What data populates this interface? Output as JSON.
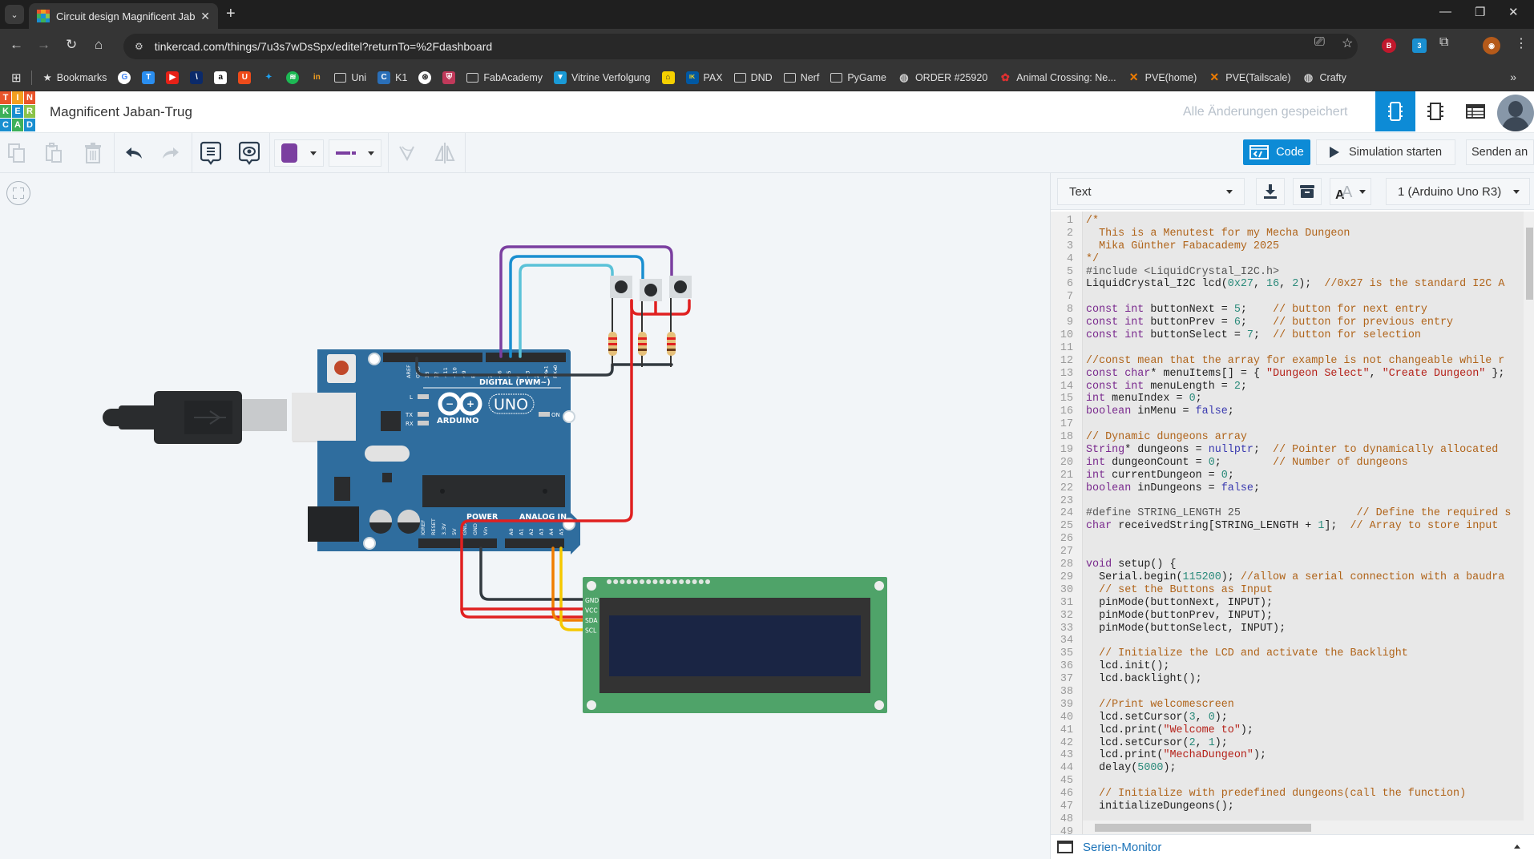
{
  "browser": {
    "tab_title": "Circuit design Magnificent Jaban-Trug",
    "url": "tinkercad.com/things/7u3s7wDsSpx/editel?returnTo=%2Fdashboard",
    "bookmarks_label": "Bookmarks",
    "bookmarks": [
      {
        "label": "Uni",
        "icon": "folder-icon"
      },
      {
        "label": "K1",
        "icon": "k1-icon"
      },
      {
        "label": "FabAcademy",
        "icon": "folder-icon"
      },
      {
        "label": "Vitrine Verfolgung",
        "icon": "vitrine-icon"
      },
      {
        "label": "PAX",
        "icon": "ikea-icon"
      },
      {
        "label": "DND",
        "icon": "folder-icon"
      },
      {
        "label": "Nerf",
        "icon": "folder-icon"
      },
      {
        "label": "PyGame",
        "icon": "folder-icon"
      },
      {
        "label": "ORDER #25920",
        "icon": "globe-icon"
      },
      {
        "label": "Animal Crossing: Ne...",
        "icon": "animal-crossing-icon"
      },
      {
        "label": "PVE(home)",
        "icon": "proxmox-icon"
      },
      {
        "label": "PVE(Tailscale)",
        "icon": "proxmox-icon"
      },
      {
        "label": "Crafty",
        "icon": "globe-icon"
      }
    ],
    "extension_badge": "3"
  },
  "app": {
    "logo_letters": [
      "T",
      "I",
      "N",
      "K",
      "E",
      "R",
      "C",
      "A",
      "D"
    ],
    "project_title": "Magnificent Jaban-Trug",
    "save_status": "Alle Änderungen gespeichert",
    "code_button": "Code",
    "simulate_button": "Simulation starten",
    "send_button": "Senden an",
    "selected_color": "#7b3fa0",
    "accent_color": "#0d8bd6"
  },
  "code_panel": {
    "mode": "Text",
    "device": "1 (Arduino Uno R3)",
    "serial_monitor": "Serien-Monitor",
    "lines": [
      "/*",
      "  This is a Menutest for my Mecha Dungeon",
      "  Mika Günther Fabacademy 2025",
      "*/",
      "#include <LiquidCrystal_I2C.h>",
      "LiquidCrystal_I2C lcd(0x27, 16, 2);  //0x27 is the standard I2C A",
      "",
      "const int buttonNext = 5;    // button for next entry",
      "const int buttonPrev = 6;    // button for previous entry",
      "const int buttonSelect = 7;  // button for selection",
      "",
      "//const mean that the array for example is not changeable while r",
      "const char* menuItems[] = { \"Dungeon Select\", \"Create Dungeon\" };",
      "const int menuLength = 2;",
      "int menuIndex = 0;",
      "boolean inMenu = false;",
      "",
      "// Dynamic dungeons array",
      "String* dungeons = nullptr;  // Pointer to dynamically allocated",
      "int dungeonCount = 0;        // Number of dungeons",
      "int currentDungeon = 0;",
      "boolean inDungeons = false;",
      "",
      "#define STRING_LENGTH 25                  // Define the required s",
      "char receivedString[STRING_LENGTH + 1];  // Array to store input",
      "",
      "",
      "void setup() {",
      "  Serial.begin(115200); //allow a serial connection with a baudra",
      "  // set the Buttons as Input",
      "  pinMode(buttonNext, INPUT);",
      "  pinMode(buttonPrev, INPUT);",
      "  pinMode(buttonSelect, INPUT);",
      "",
      "  // Initialize the LCD and activate the Backlight",
      "  lcd.init();",
      "  lcd.backlight();",
      "",
      "  //Print welcomescreen",
      "  lcd.setCursor(3, 0);",
      "  lcd.print(\"Welcome to\");",
      "  lcd.setCursor(2, 1);",
      "  lcd.print(\"MechaDungeon\");",
      "  delay(5000);",
      "",
      "  // Initialize with predefined dungeons(call the function)",
      "  initializeDungeons();",
      "",
      ""
    ]
  },
  "circuit": {
    "board_brand": "ARDUINO",
    "board_model": "UNO",
    "digital_label": "DIGITAL (PWM~)",
    "power_label": "POWER",
    "analog_label": "ANALOG IN",
    "digital_pins": [
      "AREF",
      "GND",
      "13",
      "12",
      "~11",
      "~10",
      "~9",
      "8",
      "7",
      "~6",
      "~5",
      "4",
      "~3",
      "2",
      "TX▸1",
      "RX◂0"
    ],
    "power_pins": [
      "IOREF",
      "RESET",
      "3.3V",
      "5V",
      "GND",
      "GND",
      "Vin"
    ],
    "analog_pins": [
      "A0",
      "A1",
      "A2",
      "A3",
      "A4",
      "A5"
    ],
    "led_labels": [
      "L",
      "TX",
      "RX",
      "ON"
    ],
    "lcd_pins": [
      "GND",
      "VCC",
      "SDA",
      "SCL"
    ],
    "wire_colors": {
      "purple": "#7b3fa0",
      "blue": "#1a8fd0",
      "lightblue": "#5bc2d8",
      "red": "#e02020",
      "black": "#333a40",
      "orange": "#f07d00",
      "yellow": "#f5c800"
    }
  }
}
